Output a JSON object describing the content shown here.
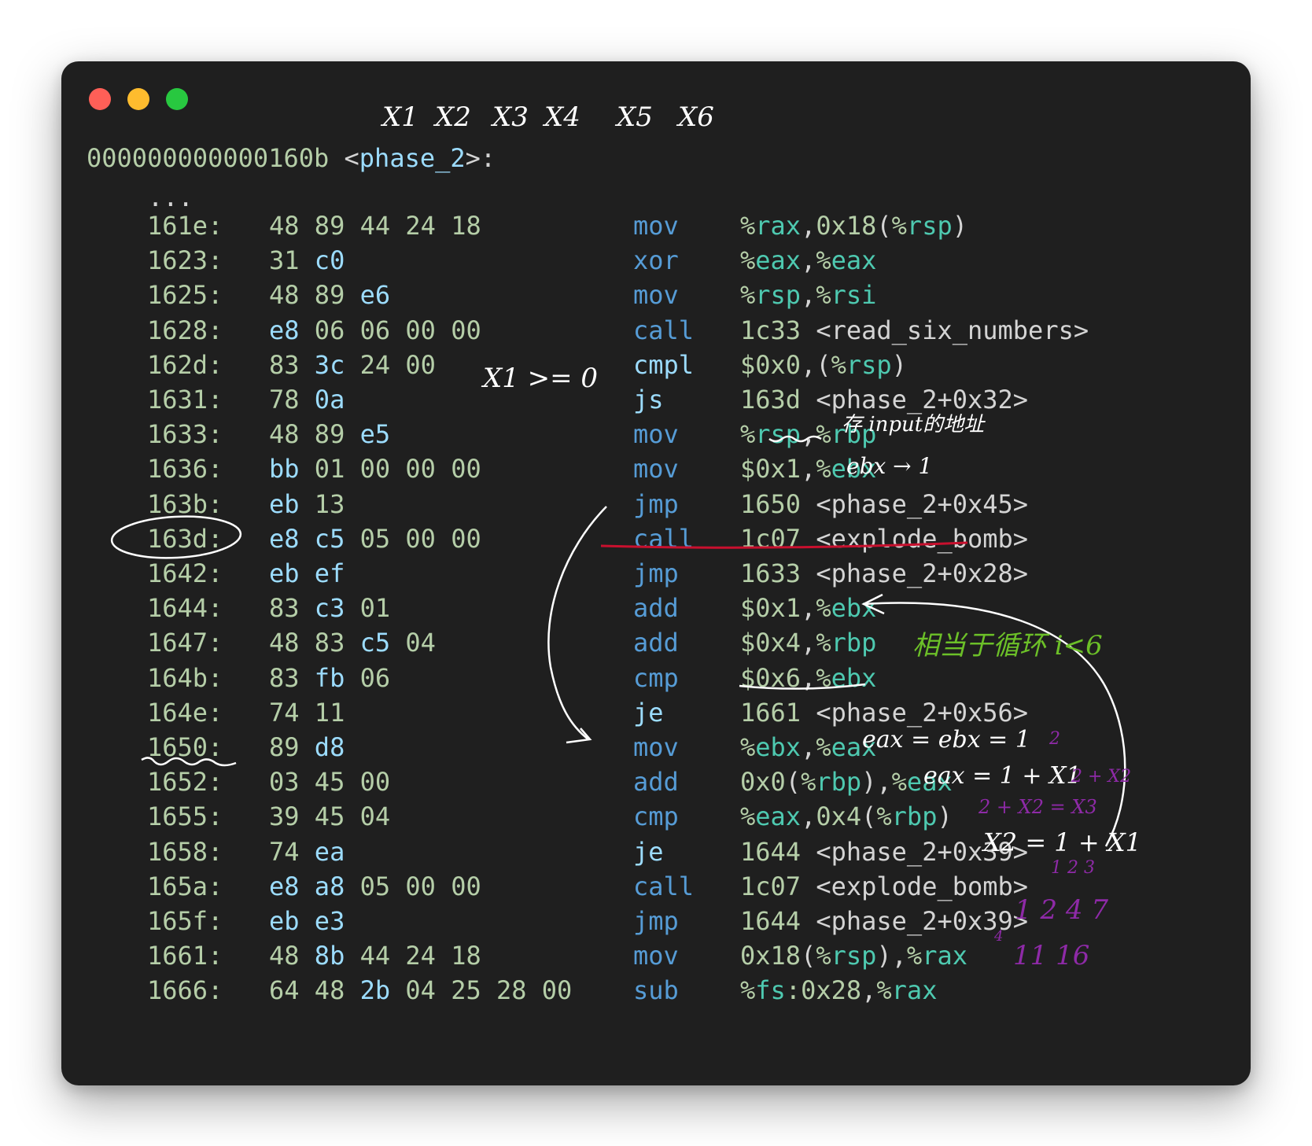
{
  "window": {
    "buttons": [
      "close",
      "minimize",
      "maximize"
    ],
    "colors": {
      "background": "#1f1f1f",
      "close": "#ff5f57",
      "minimize": "#febc2e",
      "maximize": "#28c840"
    }
  },
  "header": {
    "address": "000000000000160b",
    "symbol": "phase_2"
  },
  "ellipsis": "...",
  "rows": [
    {
      "addr": "161e:",
      "bytes": "48 89 44 24 18",
      "mnemonic": "mov",
      "operands": "%rax,0x18(%rsp)"
    },
    {
      "addr": "1623:",
      "bytes": "31 c0",
      "mnemonic": "xor",
      "operands": "%eax,%eax"
    },
    {
      "addr": "1625:",
      "bytes": "48 89 e6",
      "mnemonic": "mov",
      "operands": "%rsp,%rsi"
    },
    {
      "addr": "1628:",
      "bytes": "e8 06 06 00 00",
      "mnemonic": "call",
      "operands": "1c33 <read_six_numbers>"
    },
    {
      "addr": "162d:",
      "bytes": "83 3c 24 00",
      "mnemonic": "cmpl",
      "operands": "$0x0,(%rsp)"
    },
    {
      "addr": "1631:",
      "bytes": "78 0a",
      "mnemonic": "js",
      "operands": "163d <phase_2+0x32>"
    },
    {
      "addr": "1633:",
      "bytes": "48 89 e5",
      "mnemonic": "mov",
      "operands": "%rsp,%rbp"
    },
    {
      "addr": "1636:",
      "bytes": "bb 01 00 00 00",
      "mnemonic": "mov",
      "operands": "$0x1,%ebx"
    },
    {
      "addr": "163b:",
      "bytes": "eb 13",
      "mnemonic": "jmp",
      "operands": "1650 <phase_2+0x45>"
    },
    {
      "addr": "163d:",
      "bytes": "e8 c5 05 00 00",
      "mnemonic": "call",
      "operands": "1c07 <explode_bomb>"
    },
    {
      "addr": "1642:",
      "bytes": "eb ef",
      "mnemonic": "jmp",
      "operands": "1633 <phase_2+0x28>"
    },
    {
      "addr": "1644:",
      "bytes": "83 c3 01",
      "mnemonic": "add",
      "operands": "$0x1,%ebx"
    },
    {
      "addr": "1647:",
      "bytes": "48 83 c5 04",
      "mnemonic": "add",
      "operands": "$0x4,%rbp"
    },
    {
      "addr": "164b:",
      "bytes": "83 fb 06",
      "mnemonic": "cmp",
      "operands": "$0x6,%ebx"
    },
    {
      "addr": "164e:",
      "bytes": "74 11",
      "mnemonic": "je",
      "operands": "1661 <phase_2+0x56>"
    },
    {
      "addr": "1650:",
      "bytes": "89 d8",
      "mnemonic": "mov",
      "operands": "%ebx,%eax"
    },
    {
      "addr": "1652:",
      "bytes": "03 45 00",
      "mnemonic": "add",
      "operands": "0x0(%rbp),%eax"
    },
    {
      "addr": "1655:",
      "bytes": "39 45 04",
      "mnemonic": "cmp",
      "operands": "%eax,0x4(%rbp)"
    },
    {
      "addr": "1658:",
      "bytes": "74 ea",
      "mnemonic": "je",
      "operands": "1644 <phase_2+0x39>"
    },
    {
      "addr": "165a:",
      "bytes": "e8 a8 05 00 00",
      "mnemonic": "call",
      "operands": "1c07 <explode_bomb>"
    },
    {
      "addr": "165f:",
      "bytes": "eb e3",
      "mnemonic": "jmp",
      "operands": "1644 <phase_2+0x39>"
    },
    {
      "addr": "1661:",
      "bytes": "48 8b 44 24 18",
      "mnemonic": "mov",
      "operands": "0x18(%rsp),%rax"
    },
    {
      "addr": "1666:",
      "bytes": "64 48 2b 04 25 28 00",
      "mnemonic": "sub",
      "operands": "%fs:0x28,%rax"
    }
  ],
  "annotations": {
    "top_labels": [
      "X1",
      "X2",
      "X3",
      "X4",
      "X5",
      "X6"
    ],
    "x1_condition": "X1 >= 0",
    "rbp_note": "存 input的地址",
    "ebx_note": "ebx → 1",
    "loop_note": "相当于循环 i<6",
    "eax_note_1": "eax = ebx = 1",
    "eax_note_2": "eax = 1 + X1",
    "eax_note_2_purple": "2 + X2",
    "eax_note_3_purple": "2 + X2 = X3",
    "x2_note": "X2 = 1 + X1",
    "sequence_top": "1 2 4 7",
    "sequence_top_steps": "1 2 3",
    "sequence_bottom": "11 16",
    "sequence_bottom_step": "4",
    "colors": {
      "white": "#ffffff",
      "green": "#6cc028",
      "purple": "#8e2aa7",
      "red": "#c8102e"
    }
  }
}
